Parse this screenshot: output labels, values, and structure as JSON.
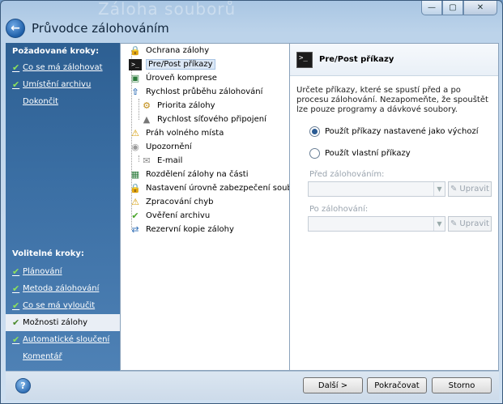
{
  "window": {
    "background_title": "Záloha souborů",
    "controls": {
      "minimize": "—",
      "maximize": "▢",
      "close": "✕"
    }
  },
  "header": {
    "title": "Průvodce zálohováním"
  },
  "required_steps": {
    "title": "Požadované kroky:",
    "items": [
      {
        "label": "Co se má zálohovat",
        "checked": true
      },
      {
        "label": "Umístění archivu",
        "checked": true
      },
      {
        "label": "Dokončit",
        "checked": false
      }
    ]
  },
  "optional_steps": {
    "title": "Volitelné kroky:",
    "items": [
      {
        "label": "Plánování",
        "checked": true
      },
      {
        "label": "Metoda zálohování",
        "checked": true
      },
      {
        "label": "Co se má vyloučit",
        "checked": true
      },
      {
        "label": "Možnosti zálohy",
        "checked": true,
        "active": true
      },
      {
        "label": "Automatické sloučení",
        "checked": true
      },
      {
        "label": "Komentář",
        "checked": false
      }
    ]
  },
  "tree": {
    "items": [
      {
        "label": "Ochrana zálohy",
        "icon": "lock-icon"
      },
      {
        "label": "Pre/Post příkazy",
        "icon": "command-prompt-icon",
        "selected": true
      },
      {
        "label": "Úroveň komprese",
        "icon": "compression-icon"
      },
      {
        "label": "Rychlost průběhu zálohování",
        "icon": "speed-arrow-icon"
      },
      {
        "label": "Priorita zálohy",
        "icon": "priority-icon"
      },
      {
        "label": "Rychlost síťového připojení",
        "icon": "network-icon"
      },
      {
        "label": "Práh volného místa",
        "icon": "warning-icon"
      },
      {
        "label": "Upozornění",
        "icon": "notification-icon"
      },
      {
        "label": "E-mail",
        "icon": "email-icon"
      },
      {
        "label": "Rozdělení zálohy na části",
        "icon": "split-icon"
      },
      {
        "label": "Nastavení úrovně zabezpečení souborů",
        "icon": "security-lock-icon"
      },
      {
        "label": "Zpracování chyb",
        "icon": "error-handling-icon"
      },
      {
        "label": "Ověření archivu",
        "icon": "verify-check-icon"
      },
      {
        "label": "Rezervní kopie zálohy",
        "icon": "reserve-copy-icon"
      }
    ]
  },
  "detail": {
    "title": "Pre/Post příkazy",
    "description": "Určete příkazy, které se spustí před a po procesu zálohování. Nezapomeňte, že spouštět lze pouze programy a dávkové soubory.",
    "option_default": "Použít příkazy nastavené jako výchozí",
    "option_custom": "Použít vlastní příkazy",
    "selected_option": "default",
    "before_label": "Před zálohováním:",
    "after_label": "Po zálohování:",
    "edit_label": "Upravit"
  },
  "footer": {
    "help": "?",
    "next": "Další >",
    "continue": "Pokračovat",
    "cancel": "Storno"
  }
}
